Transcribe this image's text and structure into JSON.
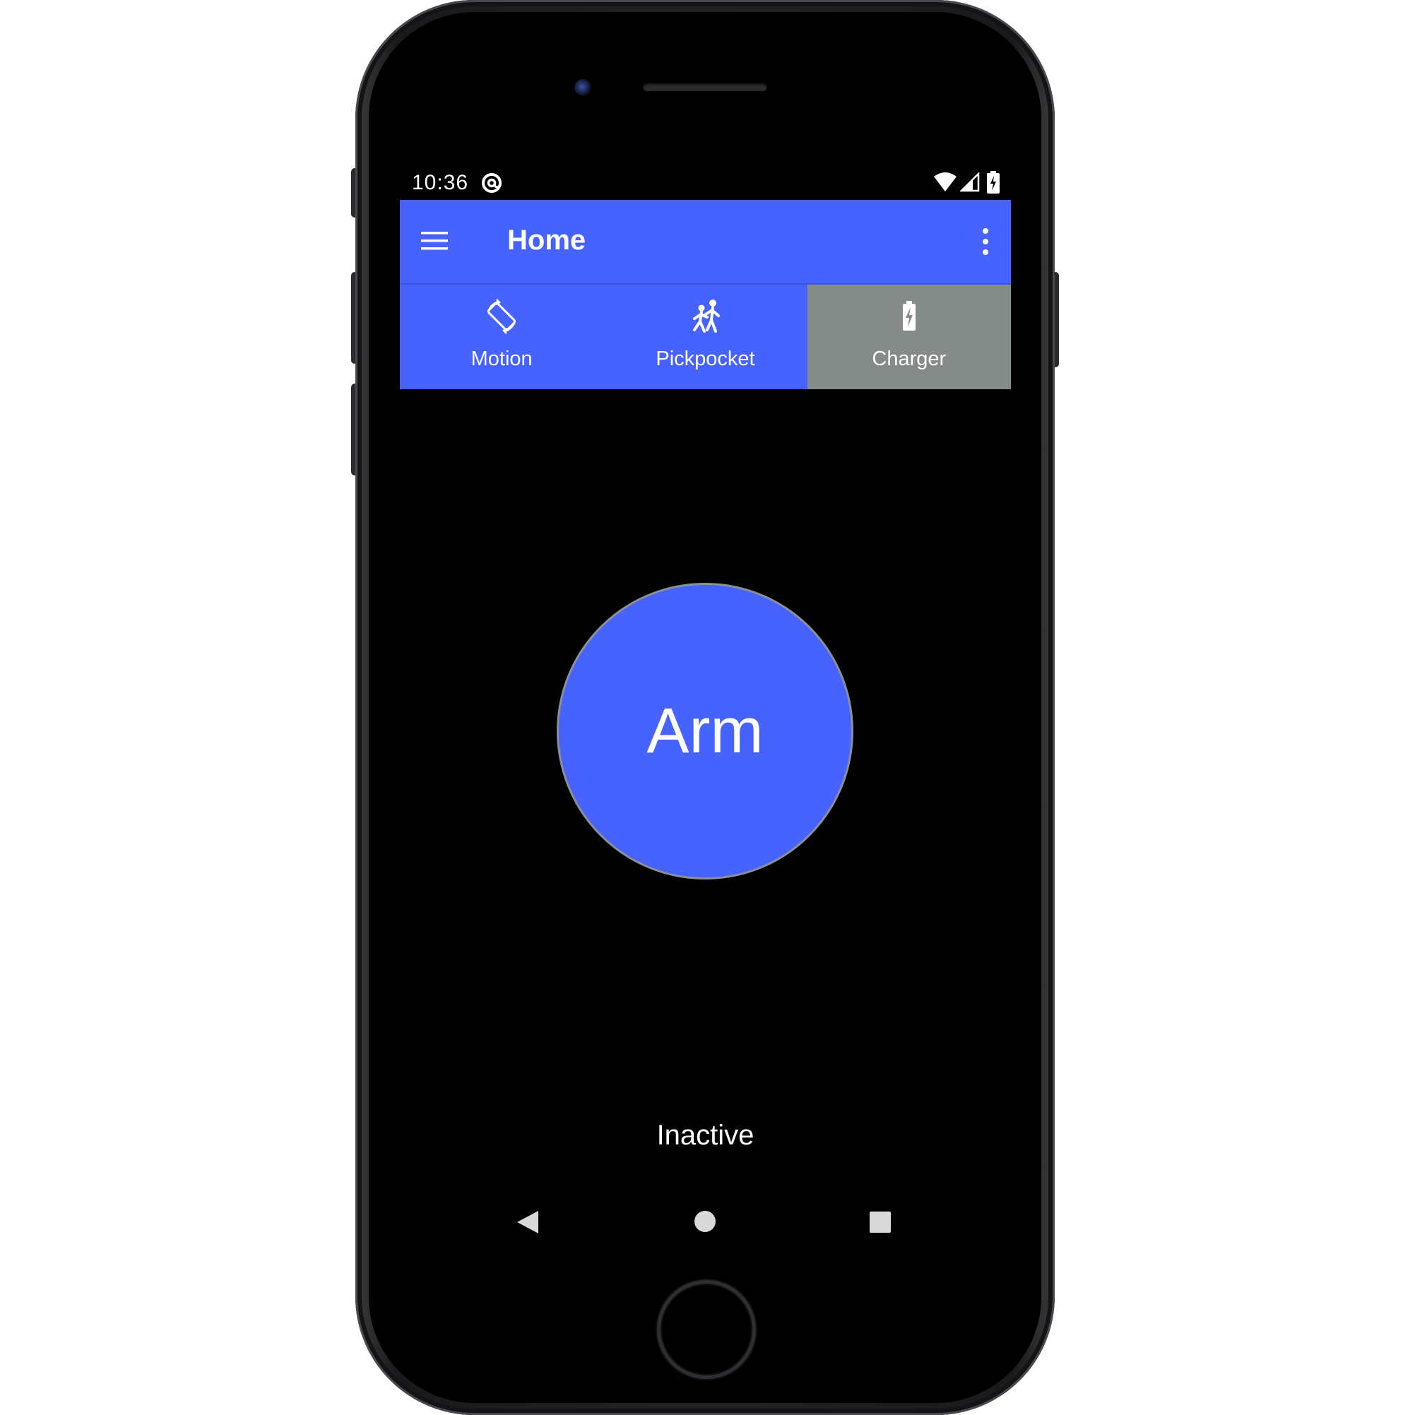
{
  "status_bar": {
    "time": "10:36",
    "icons": [
      "at-sign-icon",
      "wifi-icon",
      "cell-signal-icon",
      "battery-charging-icon"
    ]
  },
  "app_bar": {
    "title": "Home",
    "menu_icon": "hamburger-menu-icon",
    "overflow_icon": "more-vert-icon"
  },
  "tabs": [
    {
      "label": "Motion",
      "icon": "screen-rotation-icon",
      "selected": false
    },
    {
      "label": "Pickpocket",
      "icon": "pickpocket-icon",
      "selected": false
    },
    {
      "label": "Charger",
      "icon": "battery-charging-icon",
      "selected": true
    }
  ],
  "main": {
    "arm_button_label": "Arm",
    "status": "Inactive"
  },
  "nav_bar": {
    "icons": [
      "back-icon",
      "home-icon",
      "recents-icon"
    ]
  },
  "colors": {
    "primary": "#4662ff",
    "tab_selected": "#848b88",
    "screen_background": "#000000",
    "text": "#ffffff"
  }
}
